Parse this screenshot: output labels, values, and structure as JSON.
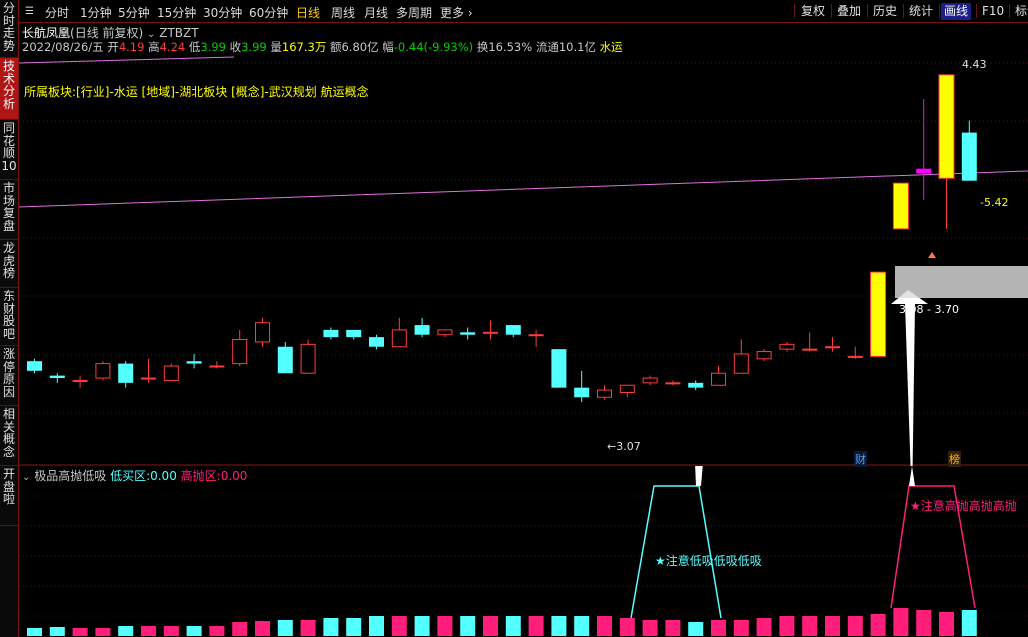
{
  "sidebar": {
    "items": [
      "分时走势",
      "技术分析",
      "同花顺10",
      "市场复盘",
      "龙虎榜",
      "东财股吧",
      "涨停原因",
      "相关概念",
      "开盘啦"
    ],
    "active_index": 1
  },
  "toolbar": {
    "timeframes": [
      "分时",
      "1分钟",
      "5分钟",
      "15分钟",
      "30分钟",
      "60分钟",
      "日线",
      "周线",
      "月线",
      "多周期",
      "更多"
    ],
    "active_timeframe": "日线",
    "buttons": [
      "复权",
      "叠加",
      "历史",
      "统计",
      "画线",
      "F10",
      "标记"
    ],
    "active_button": "画线"
  },
  "stock": {
    "name": "长航凤凰",
    "adjust_note": "(日线 前复权)",
    "formula_icon": "chevron-down-icon",
    "formula_name": "ZTBZT"
  },
  "quote": {
    "date": "2022/08/26/五",
    "open_label": "开",
    "open": "4.19",
    "high_label": "高",
    "high": "4.24",
    "low_label": "低",
    "low": "3.99",
    "close_label": "收",
    "close": "3.99",
    "volume_label": "量",
    "volume": "167.3万",
    "amount_label": "额",
    "amount": "6.80亿",
    "change_label": "幅",
    "change": "-0.44(-9.93%)",
    "turnover_label": "换",
    "turnover": "16.53%",
    "float_label": "流通",
    "float": "10.1亿",
    "sector": "水运"
  },
  "concepts": {
    "label": "所属板块:",
    "text": "[行业]-水运 [地域]-湖北板块 [概念]-武汉规划 航运概念"
  },
  "annotations": {
    "high_price": "4.43",
    "last_change": "-5.42",
    "range_text": "3.08 - 3.70",
    "low_price": "←3.07",
    "badge_cai": "财",
    "badge_bang": "榜"
  },
  "indicator": {
    "name": "极品高抛低吸",
    "buy_label": "低买区:",
    "buy_value": "0.00",
    "sell_label": "高抛区:",
    "sell_value": "0.00",
    "buy_signal_text": "★注意低吸低吸低吸",
    "sell_signal_text": "★注意高抛高抛高抛"
  },
  "colors": {
    "up": "#ff3c3c",
    "down": "#54ffff",
    "limit_up": "#ffff00",
    "magenta": "#ff00ff",
    "pink": "#ff1f7a",
    "active": "#ffcc00"
  },
  "chart_data": {
    "type": "candlestick",
    "y_range": [
      2.9,
      4.5
    ],
    "candles": [
      {
        "o": 3.24,
        "c": 3.2,
        "h": 3.25,
        "l": 3.19
      },
      {
        "o": 3.18,
        "c": 3.17,
        "h": 3.19,
        "l": 3.15
      },
      {
        "o": 3.16,
        "c": 3.16,
        "h": 3.18,
        "l": 3.13
      },
      {
        "o": 3.17,
        "c": 3.23,
        "h": 3.24,
        "l": 3.16
      },
      {
        "o": 3.23,
        "c": 3.15,
        "h": 3.24,
        "l": 3.13
      },
      {
        "o": 3.17,
        "c": 3.17,
        "h": 3.25,
        "l": 3.15
      },
      {
        "o": 3.16,
        "c": 3.22,
        "h": 3.23,
        "l": 3.16
      },
      {
        "o": 3.24,
        "c": 3.23,
        "h": 3.27,
        "l": 3.21
      },
      {
        "o": 3.22,
        "c": 3.22,
        "h": 3.24,
        "l": 3.21
      },
      {
        "o": 3.23,
        "c": 3.33,
        "h": 3.37,
        "l": 3.22
      },
      {
        "o": 3.32,
        "c": 3.4,
        "h": 3.42,
        "l": 3.3
      },
      {
        "o": 3.3,
        "c": 3.19,
        "h": 3.32,
        "l": 3.19
      },
      {
        "o": 3.19,
        "c": 3.31,
        "h": 3.33,
        "l": 3.19
      },
      {
        "o": 3.37,
        "c": 3.34,
        "h": 3.38,
        "l": 3.33
      },
      {
        "o": 3.37,
        "c": 3.34,
        "h": 3.37,
        "l": 3.33
      },
      {
        "o": 3.34,
        "c": 3.3,
        "h": 3.35,
        "l": 3.29
      },
      {
        "o": 3.3,
        "c": 3.37,
        "h": 3.42,
        "l": 3.3
      },
      {
        "o": 3.39,
        "c": 3.35,
        "h": 3.42,
        "l": 3.34
      },
      {
        "o": 3.35,
        "c": 3.37,
        "h": 3.37,
        "l": 3.34
      },
      {
        "o": 3.36,
        "c": 3.35,
        "h": 3.38,
        "l": 3.33
      },
      {
        "o": 3.36,
        "c": 3.36,
        "h": 3.41,
        "l": 3.33
      },
      {
        "o": 3.39,
        "c": 3.35,
        "h": 3.39,
        "l": 3.34
      },
      {
        "o": 3.35,
        "c": 3.35,
        "h": 3.37,
        "l": 3.3
      },
      {
        "o": 3.29,
        "c": 3.13,
        "h": 3.29,
        "l": 3.13
      },
      {
        "o": 3.13,
        "c": 3.09,
        "h": 3.2,
        "l": 3.07
      },
      {
        "o": 3.09,
        "c": 3.12,
        "h": 3.14,
        "l": 3.08
      },
      {
        "o": 3.11,
        "c": 3.14,
        "h": 3.14,
        "l": 3.09
      },
      {
        "o": 3.15,
        "c": 3.17,
        "h": 3.18,
        "l": 3.14
      },
      {
        "o": 3.15,
        "c": 3.15,
        "h": 3.16,
        "l": 3.14
      },
      {
        "o": 3.15,
        "c": 3.13,
        "h": 3.16,
        "l": 3.12
      },
      {
        "o": 3.14,
        "c": 3.19,
        "h": 3.22,
        "l": 3.14
      },
      {
        "o": 3.19,
        "c": 3.27,
        "h": 3.33,
        "l": 3.19
      },
      {
        "o": 3.25,
        "c": 3.28,
        "h": 3.29,
        "l": 3.24
      },
      {
        "o": 3.29,
        "c": 3.31,
        "h": 3.32,
        "l": 3.28
      },
      {
        "o": 3.29,
        "c": 3.29,
        "h": 3.36,
        "l": 3.28
      },
      {
        "o": 3.3,
        "c": 3.3,
        "h": 3.34,
        "l": 3.28
      },
      {
        "o": 3.26,
        "c": 3.26,
        "h": 3.3,
        "l": 3.25
      },
      {
        "o": 3.26,
        "c": 3.61,
        "h": 3.61,
        "l": 3.26,
        "limit": true
      },
      {
        "o": 3.79,
        "c": 3.98,
        "h": 3.98,
        "l": 3.79,
        "limit": true
      },
      {
        "o": 4.04,
        "c": 4.02,
        "h": 4.33,
        "l": 3.91,
        "magenta": true
      },
      {
        "o": 4.0,
        "c": 4.43,
        "h": 4.43,
        "l": 3.79,
        "limit": true
      },
      {
        "o": 4.19,
        "c": 3.99,
        "h": 4.24,
        "l": 3.99
      }
    ],
    "volume": [
      8,
      9,
      8,
      8,
      10,
      10,
      10,
      10,
      10,
      14,
      15,
      16,
      16,
      18,
      18,
      20,
      20,
      20,
      20,
      20,
      20,
      20,
      20,
      20,
      20,
      20,
      18,
      16,
      16,
      14,
      16,
      16,
      18,
      20,
      20,
      20,
      20,
      22,
      28,
      26,
      24,
      26
    ]
  }
}
